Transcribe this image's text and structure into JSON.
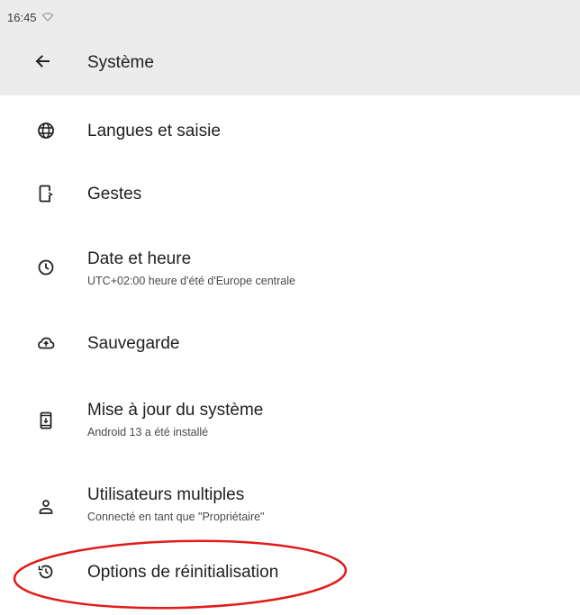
{
  "status_bar": {
    "time": "16:45",
    "icons": [
      "wifi-icon"
    ]
  },
  "toolbar": {
    "back_icon": "arrow-back-icon",
    "title": "Système"
  },
  "settings": [
    {
      "icon": "globe-icon",
      "title": "Langues et saisie",
      "summary": ""
    },
    {
      "icon": "gestures-phone-icon",
      "title": "Gestes",
      "summary": ""
    },
    {
      "icon": "clock-icon",
      "title": "Date et heure",
      "summary": "UTC+02:00 heure d'été d'Europe centrale"
    },
    {
      "icon": "cloud-upload-icon",
      "title": "Sauvegarde",
      "summary": ""
    },
    {
      "icon": "system-update-icon",
      "title": "Mise à jour du système",
      "summary": "Android 13 a été installé"
    },
    {
      "icon": "person-icon",
      "title": "Utilisateurs multiples",
      "summary": "Connecté en tant que \"Propriétaire\""
    },
    {
      "icon": "history-icon",
      "title": "Options de réinitialisation",
      "summary": ""
    }
  ],
  "annotation": {
    "shape": "ellipse",
    "color": "#e01b1b",
    "target": "Options de réinitialisation"
  },
  "colors": {
    "header_bg": "#ececec",
    "text_primary": "#1f1f1f",
    "text_secondary": "#4a4a4a"
  }
}
